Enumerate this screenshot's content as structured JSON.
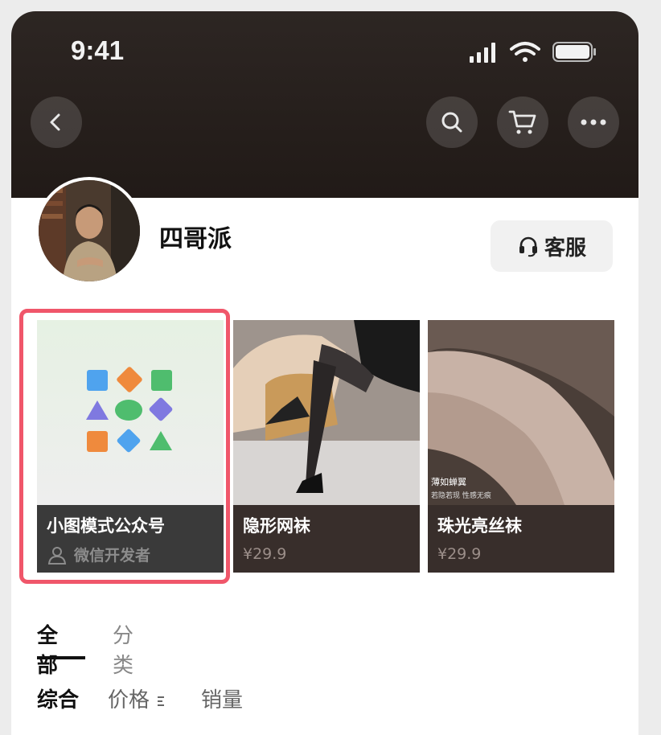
{
  "status_bar": {
    "time": "9:41"
  },
  "nav": {
    "back_icon": "chevron-left-icon",
    "search_icon": "search-icon",
    "cart_icon": "cart-icon",
    "more_icon": "more-icon"
  },
  "shop": {
    "name": "四哥派",
    "service_label": "客服"
  },
  "products": [
    {
      "title": "小图模式公众号",
      "subtitle": "微信开发者"
    },
    {
      "title": "隐形网袜",
      "price": "¥29.9"
    },
    {
      "title": "珠光亮丝袜",
      "price": "¥29.9",
      "image_caption": "薄如蝉翼",
      "image_subcaption": "若隐若现 性感无痕"
    }
  ],
  "tabs": {
    "all": "全部",
    "category": "分类"
  },
  "sort": {
    "comprehensive": "综合",
    "price": "价格",
    "sales": "销量"
  },
  "colors": {
    "header_bg": "#2a2320",
    "highlight": "#f0566a",
    "card_bar": "#382e2b"
  }
}
